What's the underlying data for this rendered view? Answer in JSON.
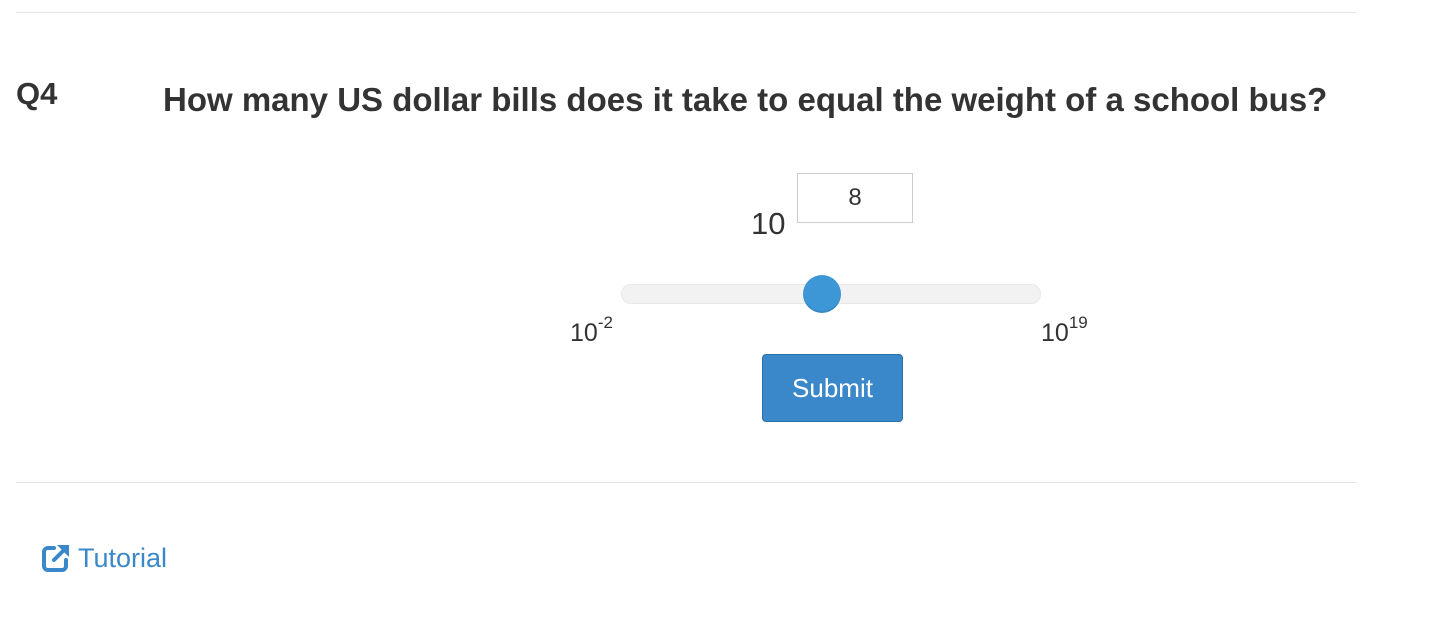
{
  "question": {
    "number": "Q4",
    "text": "How many US dollar bills does it take to equal the weight of a school bus?"
  },
  "answer": {
    "base": "10",
    "exponent_value": "8",
    "slider": {
      "min_exponent": -2,
      "max_exponent": 19,
      "current_exponent": 8,
      "min_label_base": "10",
      "min_label_exponent": "-2",
      "max_label_base": "10",
      "max_label_exponent": "19"
    },
    "submit_label": "Submit"
  },
  "footer": {
    "tutorial_label": "Tutorial",
    "tutorial_icon": "external-link-icon"
  },
  "colors": {
    "accent": "#3a88ca",
    "slider_thumb": "#3d96d6",
    "text": "#333333"
  }
}
